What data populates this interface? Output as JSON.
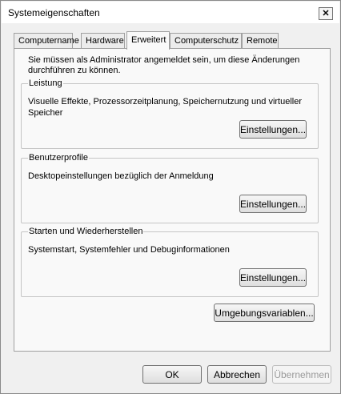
{
  "window": {
    "title": "Systemeigenschaften",
    "close_symbol": "✕"
  },
  "tabs": [
    {
      "label": "Computername",
      "active": false
    },
    {
      "label": "Hardware",
      "active": false
    },
    {
      "label": "Erweitert",
      "active": true
    },
    {
      "label": "Computerschutz",
      "active": false
    },
    {
      "label": "Remote",
      "active": false
    }
  ],
  "panel": {
    "intro": "Sie müssen als Administrator angemeldet sein, um diese Änderungen durchführen zu können.",
    "groups": [
      {
        "title": "Leistung",
        "description": "Visuelle Effekte, Prozessorzeitplanung, Speichernutzung und virtueller Speicher",
        "button": "Einstellungen..."
      },
      {
        "title": "Benutzerprofile",
        "description": "Desktopeinstellungen bezüglich der Anmeldung",
        "button": "Einstellungen..."
      },
      {
        "title": "Starten und Wiederherstellen",
        "description": "Systemstart, Systemfehler und Debuginformationen",
        "button": "Einstellungen..."
      }
    ],
    "env_button": "Umgebungsvariablen..."
  },
  "footer": {
    "ok": "OK",
    "cancel": "Abbrechen",
    "apply": "Übernehmen"
  }
}
